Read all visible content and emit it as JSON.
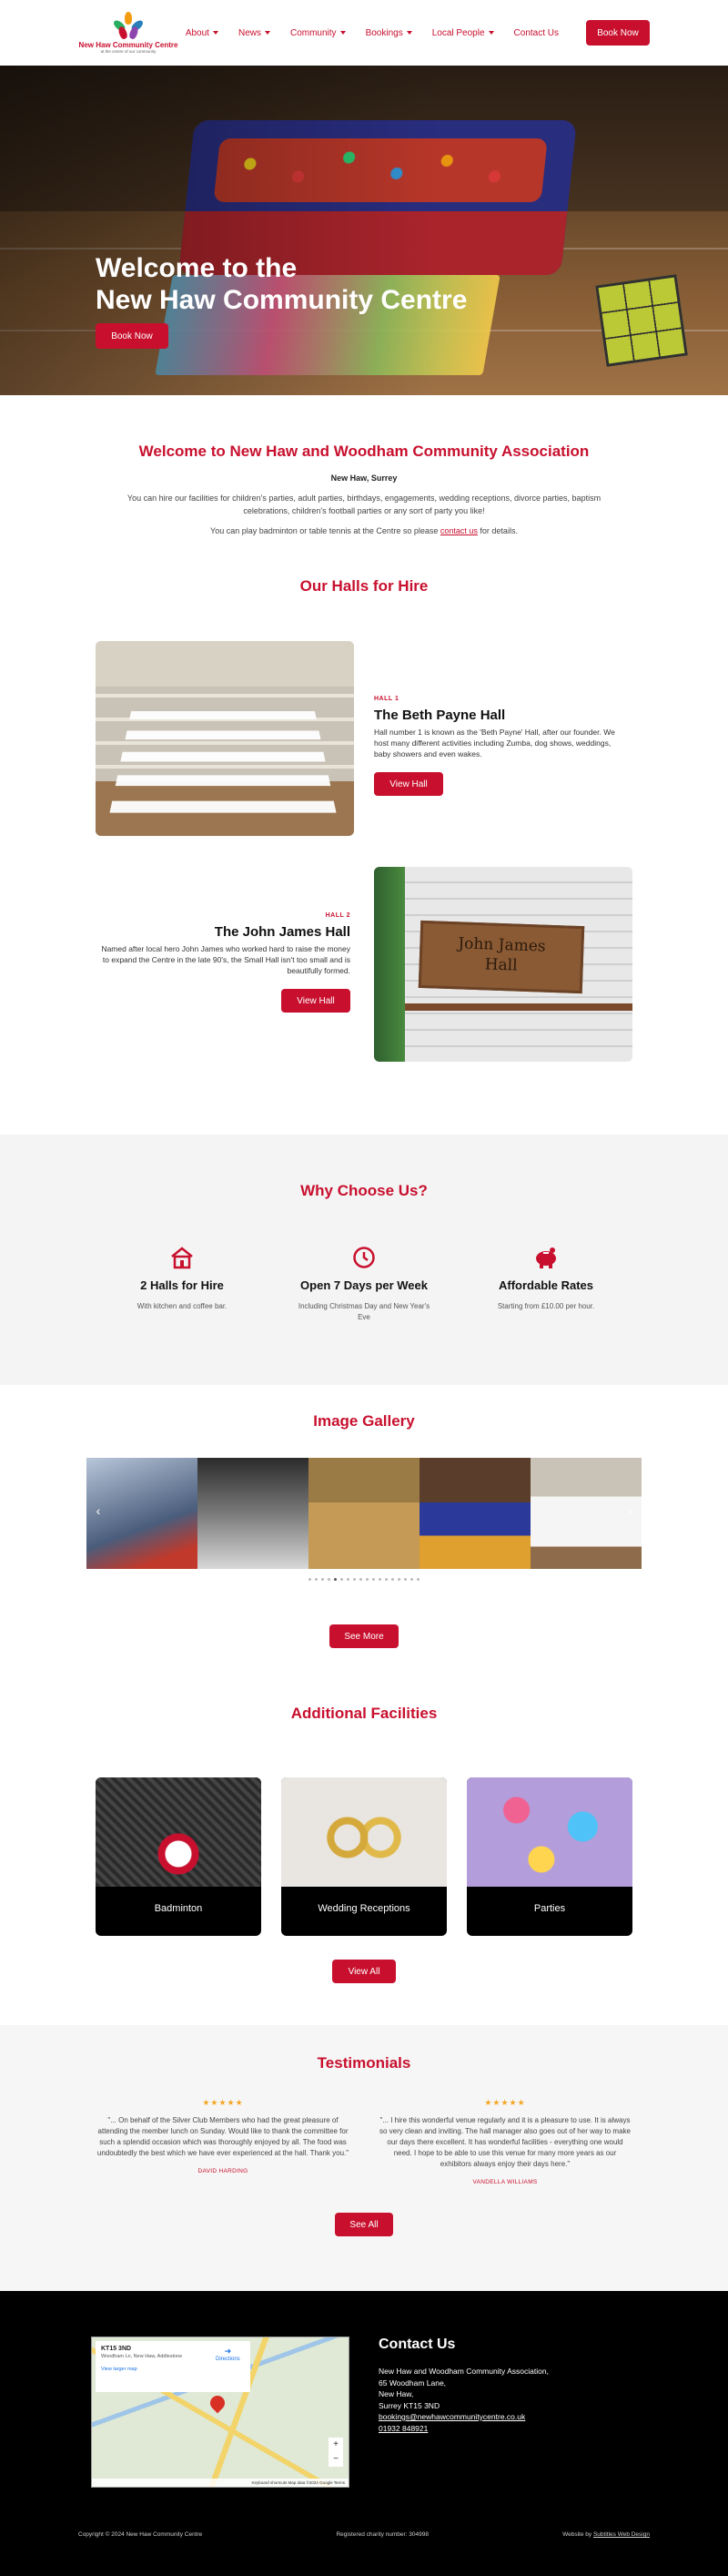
{
  "header": {
    "logo_name": "New Haw Community Centre",
    "logo_tagline": "at the centre of our community",
    "nav": [
      {
        "label": "About",
        "dropdown": true
      },
      {
        "label": "News",
        "dropdown": true
      },
      {
        "label": "Community",
        "dropdown": true
      },
      {
        "label": "Bookings",
        "dropdown": true
      },
      {
        "label": "Local People",
        "dropdown": true
      },
      {
        "label": "Contact Us",
        "dropdown": false
      }
    ],
    "book_label": "Book Now"
  },
  "hero": {
    "title_line1": "Welcome to the",
    "title_line2": "New Haw Community Centre",
    "button_label": "Book Now"
  },
  "welcome": {
    "title": "Welcome to New Haw and Woodham Community Association",
    "subtitle": "New Haw, Surrey",
    "paragraph": "You can hire our facilities for children's parties, adult parties, birthdays, engagements, wedding receptions, divorce parties, baptism celebrations, children's football parties or any sort of party you like!",
    "play_text_before": "You can play badminton or table tennis at the Centre so please ",
    "play_link": "contact us",
    "play_text_after": " for details."
  },
  "halls": {
    "title": "Our Halls for Hire",
    "items": [
      {
        "tag": "HALL 1",
        "name": "The Beth Payne Hall",
        "description": "Hall number 1 is known as the 'Beth Payne' Hall, after our founder. We host many different activities including Zumba, dog shows, weddings, baby showers and even wakes.",
        "button": "View Hall"
      },
      {
        "tag": "HALL 2",
        "name": "The John James Hall",
        "description": "Named after local hero John James who worked hard to raise the money to expand the Centre in the late 90's, the Small Hall isn't too small and is beautifully formed.",
        "button": "View Hall",
        "sign_line1": "John James",
        "sign_line2": "Hall"
      }
    ]
  },
  "why": {
    "title": "Why Choose Us?",
    "features": [
      {
        "icon": "house-icon",
        "title": "2 Halls for Hire",
        "desc": "With kitchen and coffee bar."
      },
      {
        "icon": "clock-icon",
        "title": "Open 7 Days per Week",
        "desc": "Including Christmas Day and New Year's Eve"
      },
      {
        "icon": "piggy-bank-icon",
        "title": "Affordable Rates",
        "desc": "Starting from £10.00 per hour."
      }
    ],
    "accent_color": "#c8102e"
  },
  "gallery": {
    "title": "Image Gallery",
    "prev": "‹",
    "next": "›",
    "dot_count": 18,
    "active_dot": 4,
    "see_more": "See More"
  },
  "facilities": {
    "title": "Additional Facilities",
    "items": [
      "Badminton",
      "Wedding Receptions",
      "Parties"
    ],
    "view_all": "View All"
  },
  "testimonials": {
    "title": "Testimonials",
    "items": [
      {
        "stars": "★★★★★",
        "text": "\"... On behalf of the Silver Club Members who had the great pleasure of attending the member lunch on Sunday. Would like to thank the committee for such a splendid occasion which was thoroughly enjoyed by all. The food was undoubtedly the best which we have ever experienced at the hall. Thank you.\"",
        "name": "DAVID HARDING"
      },
      {
        "stars": "★★★★★",
        "text": "\"... I hire this wonderful venue regularly and it is a pleasure to use. It is always so very clean and inviting. The hall manager also goes out of her way to make our days there excellent. It has wonderful facilities - everything one would need. I hope to be able to use this venue for many more years as our exhibitors always enjoy their days here.\"",
        "name": "VANDELLA WILLIAMS"
      }
    ],
    "see_all": "See All"
  },
  "footer": {
    "map": {
      "place": "KT15 3ND",
      "address": "Woodham Ln, New Haw, Addlestone",
      "larger": "View larger map",
      "directions": "Directions",
      "zoom_in": "+",
      "zoom_out": "−",
      "attribution": "Keyboard shortcuts  Map data ©2024 Google  Terms"
    },
    "contact_title": "Contact Us",
    "address_lines": [
      "New Haw and Woodham Community Association,",
      "65 Woodham Lane,",
      "New Haw,",
      "Surrey KT15 3ND"
    ],
    "email": "bookings@newhawcommunitycentre.co.uk",
    "phone": "01932 848921",
    "copyright": "Copyright © 2024 New Haw Community Centre",
    "charity": "Registered charity number: 304998",
    "credit_prefix": "Website by ",
    "credit_link": "Subtitles Web Design"
  }
}
